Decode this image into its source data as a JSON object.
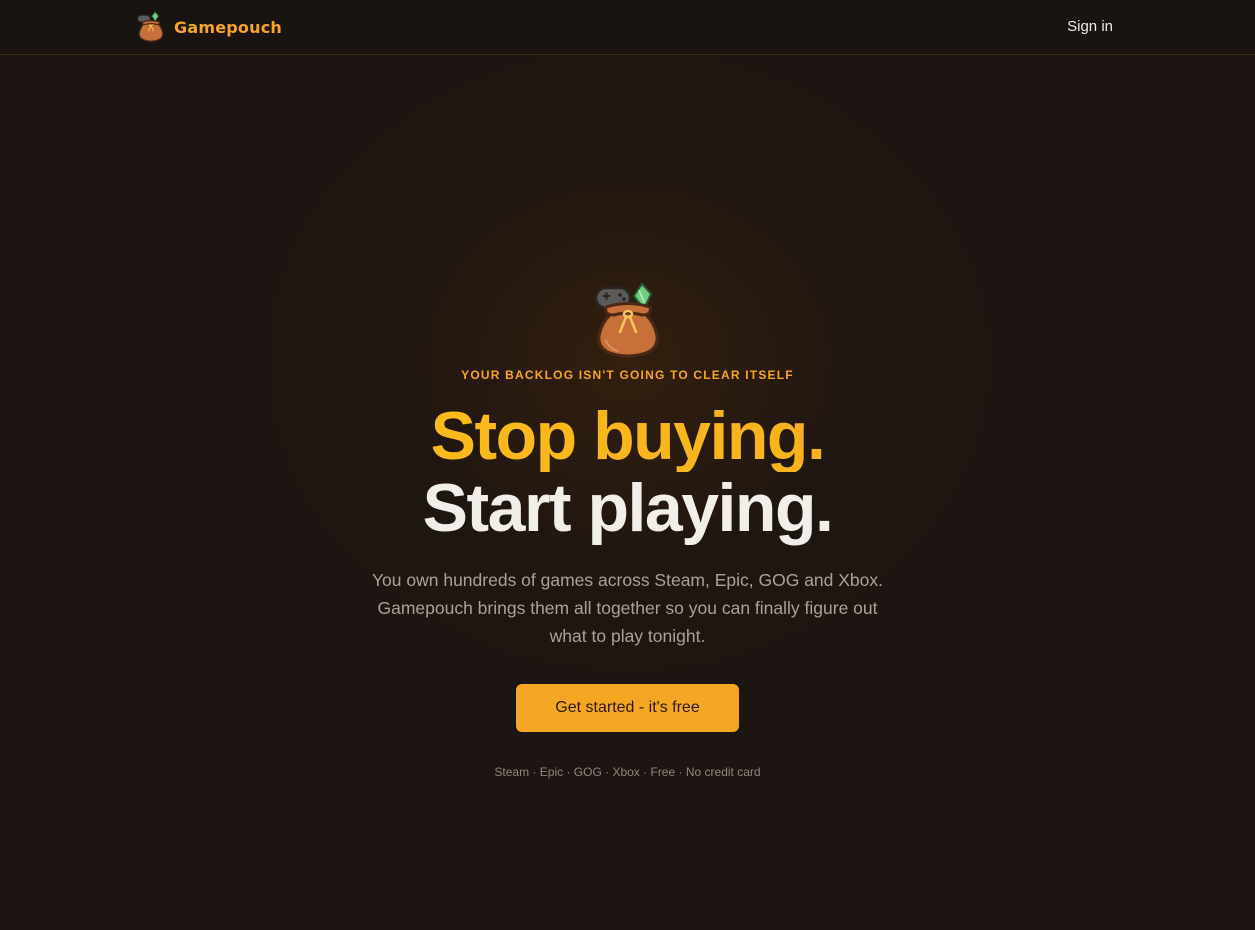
{
  "nav": {
    "brand_name": "Gamepouch",
    "signin_label": "Sign in"
  },
  "hero": {
    "eyebrow": "YOUR BACKLOG ISN'T GOING TO CLEAR ITSELF",
    "headline_line1": "Stop buying.",
    "headline_line2": "Start playing.",
    "subtitle": "You own hundreds of games across Steam, Epic, GOG and Xbox. Gamepouch brings them all together so you can finally figure out what to play tonight.",
    "cta_label": "Get started - it's free",
    "footnote": {
      "platforms": "Steam · Epic · GOG · Xbox",
      "free": "Free",
      "no_card": "No credit card",
      "separator": "·"
    }
  },
  "colors": {
    "accent": "#f5a623",
    "headline_gradient_start": "#fdc51a",
    "background": "#1c1511"
  },
  "icons": {
    "logo": "game-pouch-bag-icon"
  }
}
